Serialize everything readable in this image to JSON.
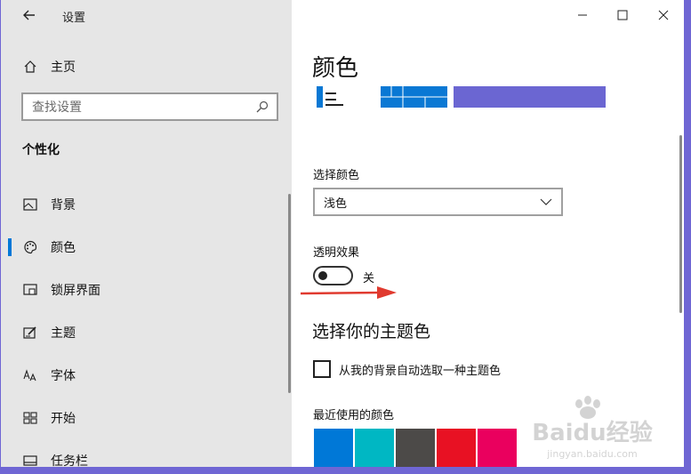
{
  "window": {
    "title": "设置",
    "controls": {
      "minimize": "—",
      "maximize": "☐",
      "close": "✕"
    }
  },
  "sidebar": {
    "back_icon": "arrow-left-icon",
    "home": {
      "label": "主页",
      "icon": "home-icon"
    },
    "search": {
      "placeholder": "查找设置",
      "icon": "search-icon"
    },
    "section_title": "个性化",
    "items": [
      {
        "label": "背景",
        "icon": "picture-icon",
        "active": false
      },
      {
        "label": "颜色",
        "icon": "palette-icon",
        "active": true
      },
      {
        "label": "锁屏界面",
        "icon": "lock-screen-icon",
        "active": false
      },
      {
        "label": "主题",
        "icon": "theme-brush-icon",
        "active": false
      },
      {
        "label": "字体",
        "icon": "font-icon",
        "active": false
      },
      {
        "label": "开始",
        "icon": "start-grid-icon",
        "active": false
      },
      {
        "label": "任务栏",
        "icon": "taskbar-icon",
        "active": false
      }
    ]
  },
  "main": {
    "title": "颜色",
    "accent_color": "#6b66d2",
    "preview_blue": "#0a78d4",
    "choose_color": {
      "label": "选择颜色",
      "selected": "浅色"
    },
    "transparency": {
      "label": "透明效果",
      "state": "关",
      "enabled": false
    },
    "accent_heading": "选择你的主题色",
    "auto_pick": {
      "label": "从我的背景自动选取一种主题色",
      "checked": false
    },
    "recent_colors": {
      "label": "最近使用的颜色",
      "colors": [
        "#0078d7",
        "#00b7c3",
        "#4c4a48",
        "#e81123",
        "#ea005e"
      ]
    }
  },
  "watermark": {
    "brand": "Baidu经验",
    "url": "jingyan.baidu.com"
  }
}
